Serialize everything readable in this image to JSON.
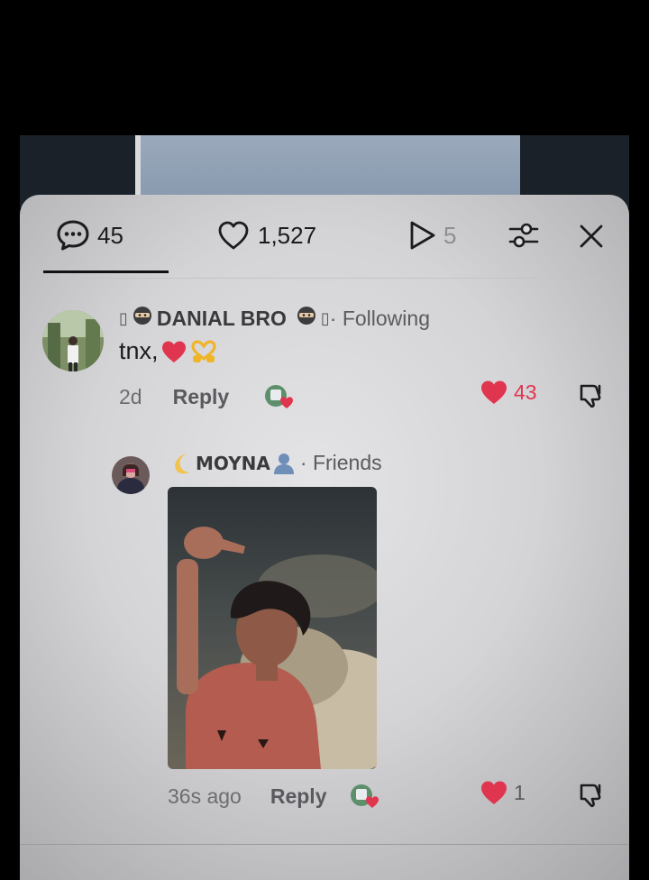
{
  "tabs": {
    "comments_count": "45",
    "likes_count": "1,527",
    "reposts_count": "5"
  },
  "comment": {
    "username": "DANIAL BRO",
    "relation": " · Following",
    "text": "tnx,",
    "time": "2d",
    "reply_label": "Reply",
    "likes": "43"
  },
  "reply": {
    "username": "MOYNA",
    "relation": " · Friends",
    "time": "36s ago",
    "reply_label": "Reply",
    "likes": "1"
  },
  "colors": {
    "like_red": "#e0354f",
    "sheet_bg": "#dcdcde",
    "text_dark": "#1c1c1e"
  },
  "icons": {
    "comments": "comment-bubble-icon",
    "likes": "heart-outline-icon",
    "reposts": "play-triangle-icon",
    "filter": "sliders-icon",
    "close": "close-icon",
    "liked": "heart-filled-icon",
    "dislike": "thumbs-down-icon",
    "reaction": "reaction-sticker-icon"
  }
}
